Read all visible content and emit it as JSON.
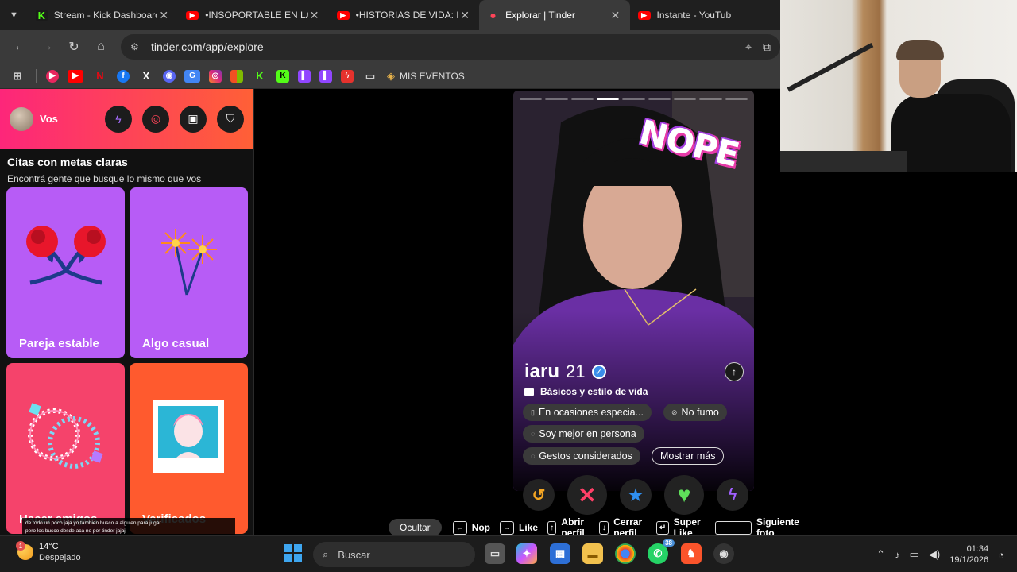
{
  "browser": {
    "tabs": [
      {
        "title": "Stream - Kick Dashboard",
        "favicon": "kick-icon"
      },
      {
        "title": "•INSOPORTABLE EN LA HEL",
        "favicon": "youtube-icon"
      },
      {
        "title": "•HISTORIAS DE VIDA: DANI",
        "favicon": "youtube-icon"
      },
      {
        "title": "Explorar | Tinder",
        "favicon": "tinder-icon",
        "active": true
      },
      {
        "title": "Instante - YouTub",
        "favicon": "youtube-icon"
      }
    ],
    "url": "tinder.com/app/explore",
    "bookmark_folder": "MIS EVENTOS"
  },
  "sidebar": {
    "user_label": "Vos",
    "section_title": "Citas con metas claras",
    "section_subtitle": "Encontrá gente que busque lo mismo que vos",
    "cards": [
      {
        "label": "Pareja estable"
      },
      {
        "label": "Algo casual"
      },
      {
        "label": "Hacer amigos"
      },
      {
        "label": "Verificados"
      }
    ],
    "caption_line1": "de todo un poco jaja yo tambien busco a alguien para jugar",
    "caption_line2": "pero los busco desde aca no por tinder jajaj"
  },
  "profile": {
    "stamp": "NOPE",
    "name": "iaru",
    "age": "21",
    "basics_heading": "Básicos y estilo de vida",
    "chips": [
      "En ocasiones especia...",
      "No fumo",
      "Soy mejor en persona",
      "Gestos considerados"
    ],
    "show_more": "Mostrar más",
    "photo_count": 9,
    "current_photo": 4
  },
  "shortcuts": {
    "hide": "Ocultar",
    "items": [
      {
        "key": "←",
        "label": "Nop"
      },
      {
        "key": "→",
        "label": "Like"
      },
      {
        "key": "↑",
        "label": "Abrir perfil"
      },
      {
        "key": "↓",
        "label": "Cerrar perfil"
      },
      {
        "key": "↵",
        "label": "Super Like"
      },
      {
        "key": "",
        "label": "Siguiente foto"
      }
    ]
  },
  "taskbar": {
    "temp": "14°C",
    "condition": "Despejado",
    "weather_badge": "1",
    "search_placeholder": "Buscar",
    "whatsapp_badge": "38",
    "time": "01:34",
    "date": "19/1/2026"
  },
  "colors": {
    "tinder_gradient_start": "#fd267a",
    "tinder_gradient_end": "#ff6036",
    "card_purple": "#b75cf6",
    "card_pink": "#f5436b",
    "card_orange": "#ff5a2e"
  }
}
